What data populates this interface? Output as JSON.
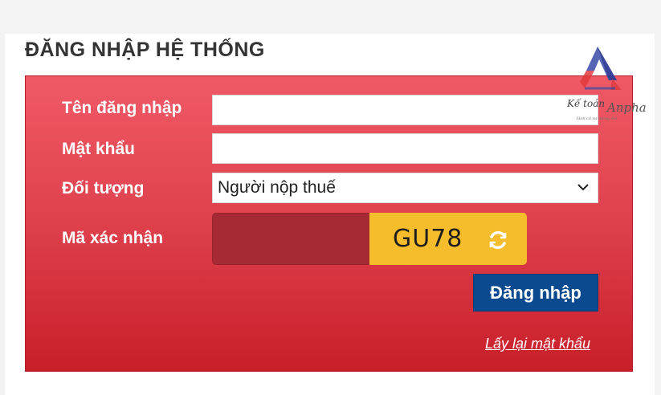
{
  "heading": "ĐĂNG NHẬP HỆ THỐNG",
  "form": {
    "username_label": "Tên đăng nhập",
    "username_value": "",
    "password_label": "Mật khẩu",
    "password_value": "",
    "subject_label": "Đối tượng",
    "subject_value": "Người nộp thuế",
    "captcha_label": "Mã xác nhận",
    "captcha_value": "",
    "captcha_code": "GU78",
    "login_button": "Đăng nhập",
    "forgot_link": "Lấy lại mật khẩu"
  },
  "watermark": {
    "text_main": "Kế toán",
    "text_brand": "Anpha",
    "tagline": "Hơn cả sự mong đợi"
  },
  "colors": {
    "panel_top": "#ef5a66",
    "panel_bottom": "#c81f2a",
    "captcha_bg": "#f5bd2c",
    "button_bg": "#0b4a8f"
  },
  "icons": {
    "select": "chevron-down-icon",
    "captcha": "refresh-icon"
  }
}
